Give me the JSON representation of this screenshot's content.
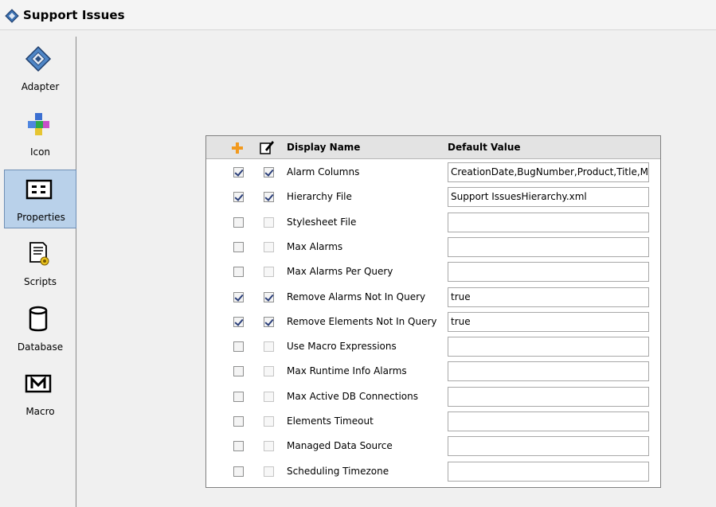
{
  "window": {
    "title": "Support Issues"
  },
  "sidebar": {
    "items": [
      {
        "label": "Adapter",
        "icon": "adapter-icon",
        "selected": false
      },
      {
        "label": "Icon",
        "icon": "icon-icon",
        "selected": false
      },
      {
        "label": "Properties",
        "icon": "properties-icon",
        "selected": true
      },
      {
        "label": "Scripts",
        "icon": "scripts-icon",
        "selected": false
      },
      {
        "label": "Database",
        "icon": "database-icon",
        "selected": false
      },
      {
        "label": "Macro",
        "icon": "macro-icon",
        "selected": false
      }
    ]
  },
  "grid": {
    "columns": {
      "display_name": "Display Name",
      "default_value": "Default Value"
    },
    "rows": [
      {
        "name": "Alarm Columns",
        "value": "CreationDate,BugNumber,Product,Title,M",
        "include": true,
        "editable": true
      },
      {
        "name": "Hierarchy File",
        "value": "Support IssuesHierarchy.xml",
        "include": true,
        "editable": true
      },
      {
        "name": "Stylesheet File",
        "value": "",
        "include": false,
        "editable": false
      },
      {
        "name": "Max Alarms",
        "value": "",
        "include": false,
        "editable": false
      },
      {
        "name": "Max Alarms Per Query",
        "value": "",
        "include": false,
        "editable": false
      },
      {
        "name": "Remove Alarms Not In Query",
        "value": "true",
        "include": true,
        "editable": true
      },
      {
        "name": "Remove Elements Not In Query",
        "value": "true",
        "include": true,
        "editable": true
      },
      {
        "name": "Use Macro Expressions",
        "value": "",
        "include": false,
        "editable": false
      },
      {
        "name": "Max Runtime Info Alarms",
        "value": "",
        "include": false,
        "editable": false
      },
      {
        "name": "Max Active DB Connections",
        "value": "",
        "include": false,
        "editable": false
      },
      {
        "name": "Elements Timeout",
        "value": "",
        "include": false,
        "editable": false
      },
      {
        "name": "Managed Data Source",
        "value": "",
        "include": false,
        "editable": false
      },
      {
        "name": "Scheduling Timezone",
        "value": "",
        "include": false,
        "editable": false
      }
    ]
  },
  "colors": {
    "selected_bg": "#b9d1ea",
    "header_bg": "#e3e3e3",
    "check_color": "#2b3f7a",
    "add_icon": "#f29a1e"
  }
}
